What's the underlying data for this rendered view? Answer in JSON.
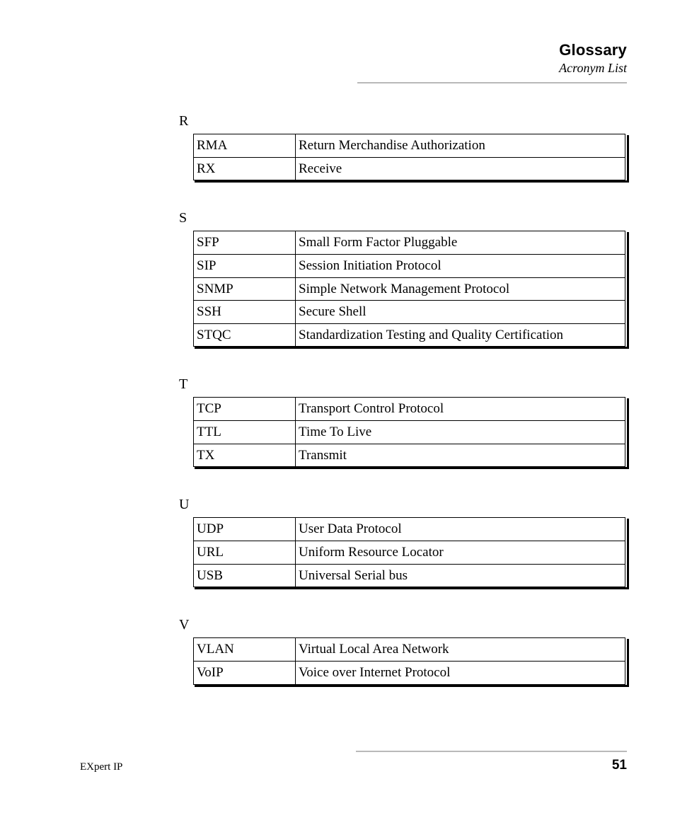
{
  "header": {
    "title": "Glossary",
    "subtitle": "Acronym List"
  },
  "sections": {
    "r": {
      "label": "R",
      "rows": [
        {
          "acro": "RMA",
          "def": "Return Merchandise Authorization"
        },
        {
          "acro": "RX",
          "def": "Receive"
        }
      ]
    },
    "s": {
      "label": "S",
      "rows": [
        {
          "acro": "SFP",
          "def": "Small Form Factor Pluggable"
        },
        {
          "acro": "SIP",
          "def": "Session Initiation Protocol"
        },
        {
          "acro": "SNMP",
          "def": "Simple Network Management Protocol"
        },
        {
          "acro": "SSH",
          "def": "Secure Shell"
        },
        {
          "acro": "STQC",
          "def": "Standardization Testing and Quality Certification"
        }
      ]
    },
    "t": {
      "label": "T",
      "rows": [
        {
          "acro": "TCP",
          "def": "Transport Control Protocol"
        },
        {
          "acro": "TTL",
          "def": "Time To Live"
        },
        {
          "acro": "TX",
          "def": "Transmit"
        }
      ]
    },
    "u": {
      "label": "U",
      "rows": [
        {
          "acro": "UDP",
          "def": "User Data Protocol"
        },
        {
          "acro": "URL",
          "def": "Uniform Resource Locator"
        },
        {
          "acro": "USB",
          "def": "Universal Serial bus"
        }
      ]
    },
    "v": {
      "label": "V",
      "rows": [
        {
          "acro": "VLAN",
          "def": "Virtual Local Area Network"
        },
        {
          "acro": "VoIP",
          "def": "Voice over Internet Protocol"
        }
      ]
    }
  },
  "footer": {
    "product": "EXpert IP",
    "page": "51"
  }
}
